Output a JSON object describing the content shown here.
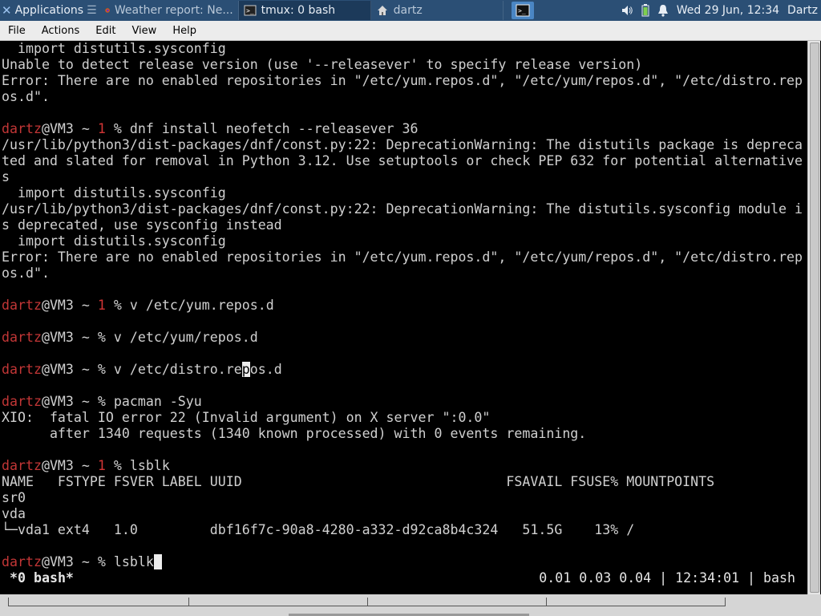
{
  "panel": {
    "applications_label": "Applications",
    "tasks": [
      {
        "label": "Weather report: Ne...",
        "icon": "firefox-icon"
      },
      {
        "label": "tmux: 0 bash",
        "icon": "terminal-icon"
      },
      {
        "label": "dartz",
        "icon": "home-folder-icon"
      }
    ],
    "clock": "Wed 29 Jun, 12:34",
    "user": "Dartz"
  },
  "menubar": {
    "file": "File",
    "actions": "Actions",
    "edit": "Edit",
    "view": "View",
    "help": "Help"
  },
  "terminal": {
    "lines": [
      "  import distutils.sysconfig",
      "Unable to detect release version (use '--releasever' to specify release version)",
      "Error: There are no enabled repositories in \"/etc/yum.repos.d\", \"/etc/yum/repos.d\", \"/etc/distro.rep",
      "os.d\".",
      "",
      {
        "user": "dartz",
        "host": "@VM3 ~ ",
        "status": "1",
        "cmd": "% dnf install neofetch --releasever 36"
      },
      "/usr/lib/python3/dist-packages/dnf/const.py:22: DeprecationWarning: The distutils package is depreca",
      "ted and slated for removal in Python 3.12. Use setuptools or check PEP 632 for potential alternative",
      "s",
      "  import distutils.sysconfig",
      "/usr/lib/python3/dist-packages/dnf/const.py:22: DeprecationWarning: The distutils.sysconfig module i",
      "s deprecated, use sysconfig instead",
      "  import distutils.sysconfig",
      "Error: There are no enabled repositories in \"/etc/yum.repos.d\", \"/etc/yum/repos.d\", \"/etc/distro.rep",
      "os.d\".",
      "",
      {
        "user": "dartz",
        "host": "@VM3 ~ ",
        "status": "1",
        "cmd": "% v /etc/yum.repos.d"
      },
      "",
      {
        "user": "dartz",
        "host": "@VM3 ~ ",
        "status": "",
        "cmd": "% v /etc/yum/repos.d"
      },
      "",
      {
        "user": "dartz",
        "host": "@VM3 ~ ",
        "status": "",
        "cmd": "% v /etc/distro.re",
        "cursor": "p",
        "after": "os.d"
      },
      "",
      {
        "user": "dartz",
        "host": "@VM3 ~ ",
        "status": "",
        "cmd": "% pacman -Syu"
      },
      "XIO:  fatal IO error 22 (Invalid argument) on X server \":0.0\"",
      "      after 1340 requests (1340 known processed) with 0 events remaining.",
      "",
      {
        "user": "dartz",
        "host": "@VM3 ~ ",
        "status": "1",
        "cmd": "% lsblk"
      },
      "NAME   FSTYPE FSVER LABEL UUID                                 FSAVAIL FSUSE% MOUNTPOINTS",
      "sr0",
      "vda",
      "└─vda1 ext4   1.0         dbf16f7c-90a8-4280-a332-d92ca8b4c324   51.5G    13% /",
      "",
      {
        "user": "dartz",
        "host": "@VM3 ~ ",
        "status": "",
        "cmd": "% lsblk",
        "cursor": " "
      }
    ]
  },
  "tmux_status": {
    "window": " *0 bash*",
    "right": "0.01 0.03 0.04 | 12:34:01 | bash"
  }
}
